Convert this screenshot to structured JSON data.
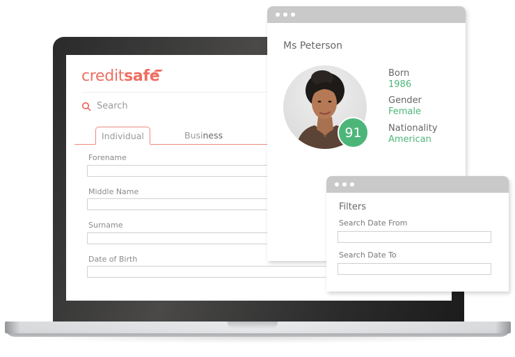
{
  "app": {
    "brand": {
      "part1": "credit",
      "part2": "safe",
      "color": "#ee6e62"
    },
    "search": {
      "icon": "search-icon",
      "label": "Search"
    },
    "tabs": [
      {
        "label": "Individual",
        "active": true
      },
      {
        "label_part1": "Busi",
        "label_part2": "ness",
        "active": false
      }
    ],
    "form": {
      "fields": [
        {
          "label": "Forename",
          "value": ""
        },
        {
          "label": "Middle Name",
          "value": ""
        },
        {
          "label": "Surname",
          "value": ""
        },
        {
          "label": "Date of Birth",
          "value": ""
        }
      ]
    }
  },
  "profile_window": {
    "title": "Ms Peterson",
    "score": "91",
    "score_color": "#4cb679",
    "details": [
      {
        "label": "Born",
        "value": "1986"
      },
      {
        "label": "Gender",
        "value": "Female"
      },
      {
        "label": "Nationality",
        "value": "American"
      }
    ]
  },
  "filters_window": {
    "title": "Filters",
    "fields": [
      {
        "label": "Search Date From",
        "value": ""
      },
      {
        "label": "Search Date To",
        "value": ""
      }
    ]
  }
}
